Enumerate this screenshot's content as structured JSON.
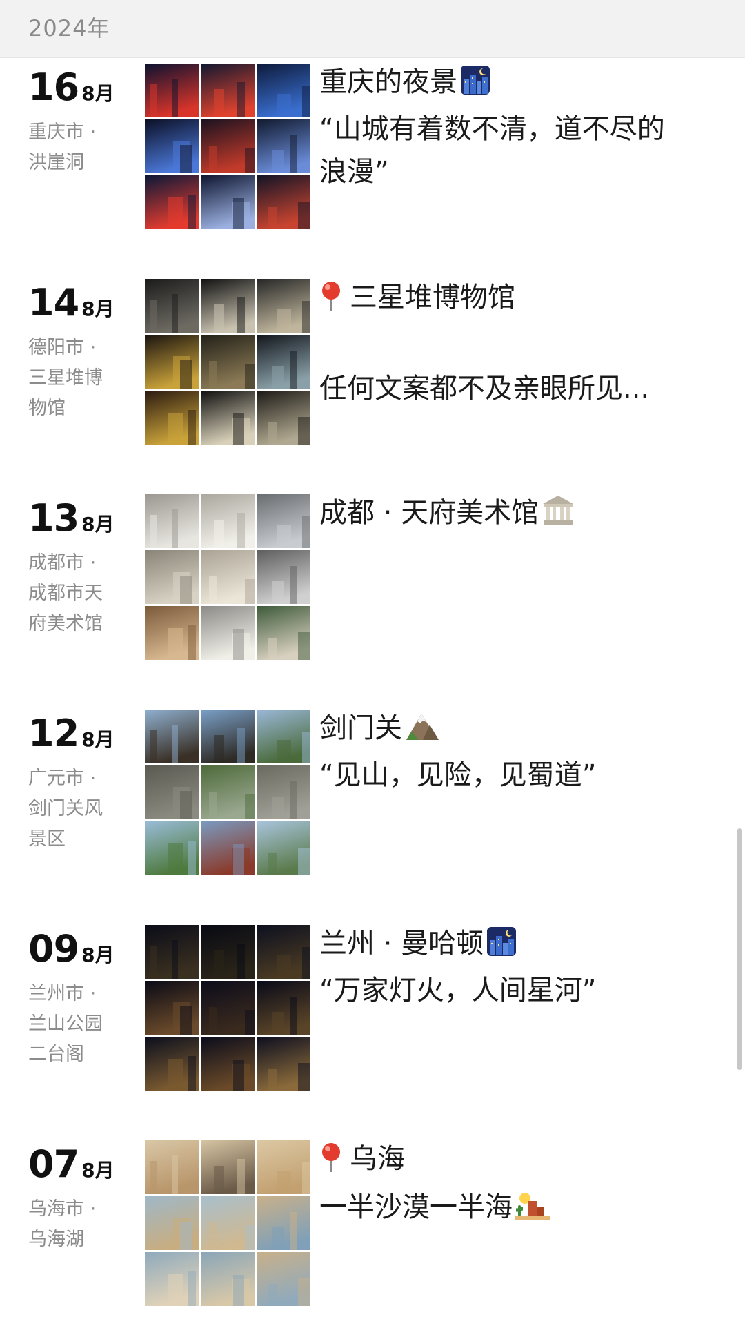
{
  "header": {
    "year": "2024年"
  },
  "posts": [
    {
      "day": "16",
      "month": "8月",
      "location": [
        "重庆市 ·",
        "洪崖洞"
      ],
      "text_lines": [
        "重庆的夜景",
        "“山城有着数不清，道不尽的",
        "浪漫”"
      ],
      "emoji": "night-city-icon",
      "pin": false
    },
    {
      "day": "14",
      "month": "8月",
      "location": [
        "德阳市 ·",
        "三星堆博",
        "物馆"
      ],
      "text_lines": [
        "三星堆博物馆",
        "",
        "任何文案都不及亲眼所见..."
      ],
      "emoji": "",
      "pin": true
    },
    {
      "day": "13",
      "month": "8月",
      "location": [
        "成都市 ·",
        "成都市天",
        "府美术馆"
      ],
      "text_lines": [
        "成都 · 天府美术馆"
      ],
      "emoji": "museum-icon",
      "pin": false
    },
    {
      "day": "12",
      "month": "8月",
      "location": [
        "广元市 ·",
        "剑门关风",
        "景区"
      ],
      "text_lines": [
        "剑门关",
        "“见山，见险，见蜀道”"
      ],
      "emoji": "mountain-icon",
      "pin": false
    },
    {
      "day": "09",
      "month": "8月",
      "location": [
        "兰州市 ·",
        "兰山公园",
        "二台阁"
      ],
      "text_lines": [
        "兰州 · 曼哈顿",
        "“万家灯火，人间星河”"
      ],
      "emoji": "night-city-icon",
      "pin": false
    },
    {
      "day": "07",
      "month": "8月",
      "location": [
        "乌海市 ·",
        "乌海湖"
      ],
      "text_lines": [
        "乌海",
        "一半沙漠一半海"
      ],
      "emoji": "desert-icon",
      "pin": true
    }
  ],
  "colors": {
    "header_bg": "#f2f2f2",
    "secondary_text": "#8c8c8c",
    "primary_text": "#1a1a1a"
  }
}
